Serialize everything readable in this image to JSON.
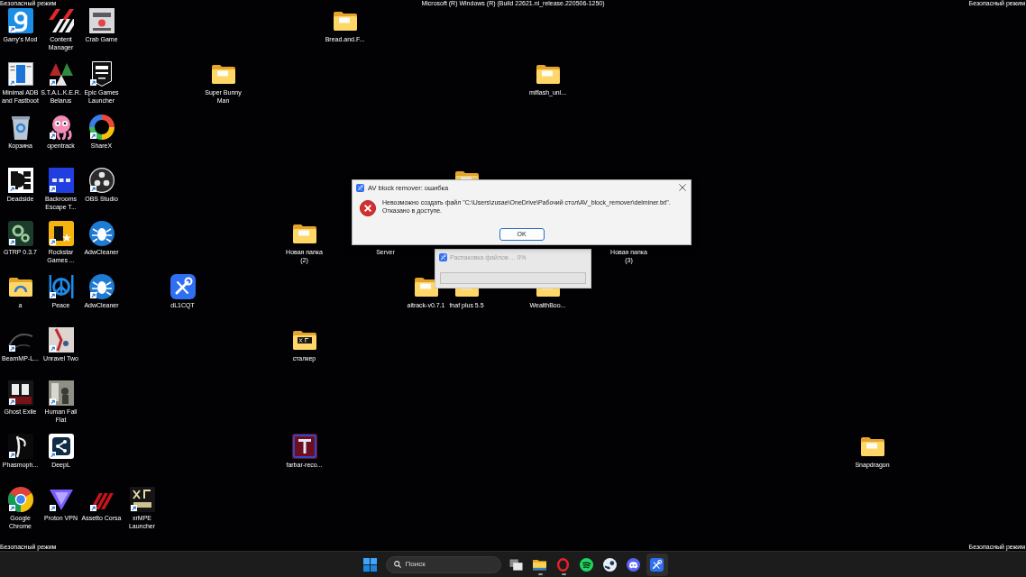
{
  "system_text": {
    "build": "Microsoft (R) Windows (R) (Build 22621.ni_release.220506-1250)",
    "safe_mode_labels": [
      "Безопасный режим",
      "Безопасный режим",
      "Безопасный режим",
      "Безопасный режим"
    ]
  },
  "desktop_icons": [
    {
      "label": "Garry's Mod",
      "kind": "app",
      "shortcut": true
    },
    {
      "label": "Content Manager",
      "kind": "app",
      "shortcut": false
    },
    {
      "label": "Crab Game",
      "kind": "app",
      "shortcut": false
    },
    {
      "label": "Bread.and.F...",
      "kind": "folder",
      "shortcut": false
    },
    {
      "label": "Minimal ADB and Fastboot",
      "kind": "app",
      "shortcut": true
    },
    {
      "label": "S.T.A.L.K.E.R. Belarus",
      "kind": "app",
      "shortcut": true
    },
    {
      "label": "Epic Games Launcher",
      "kind": "app",
      "shortcut": true
    },
    {
      "label": "Super Bunny Man",
      "kind": "folder",
      "shortcut": false
    },
    {
      "label": "miflash_unl...",
      "kind": "folder",
      "shortcut": false
    },
    {
      "label": "Корзина",
      "kind": "app",
      "shortcut": false
    },
    {
      "label": "opentrack",
      "kind": "app",
      "shortcut": true
    },
    {
      "label": "ShareX",
      "kind": "app",
      "shortcut": true
    },
    {
      "label": "Deadside",
      "kind": "app",
      "shortcut": true
    },
    {
      "label": "Backrooms Escape T...",
      "kind": "app",
      "shortcut": true
    },
    {
      "label": "OBS Studio",
      "kind": "app",
      "shortcut": true
    },
    {
      "kind": "folder"
    },
    {
      "label": "GTRP 0.3.7",
      "kind": "app",
      "shortcut": true
    },
    {
      "label": "Rockstar Games ...",
      "kind": "app",
      "shortcut": true
    },
    {
      "label": "AdwCleaner",
      "kind": "app",
      "shortcut": false
    },
    {
      "label": "Новая папка (2)",
      "kind": "folder",
      "shortcut": false
    },
    {
      "label": "Server",
      "kind": "covered"
    },
    {
      "label": "Новая папка (3)",
      "kind": "covered"
    },
    {
      "label": "a",
      "kind": "folder",
      "shortcut": false
    },
    {
      "label": "Peace",
      "kind": "app",
      "shortcut": true
    },
    {
      "label": "AdwCleaner",
      "kind": "app",
      "shortcut": true
    },
    {
      "label": "dL1CQT",
      "kind": "app",
      "shortcut": false
    },
    {
      "label": "aitrack-v0.7.1",
      "kind": "folder",
      "shortcut": false
    },
    {
      "label": "fnaf plus 5.5",
      "kind": "folder",
      "shortcut": false
    },
    {
      "label": "WealthBoo...",
      "kind": "folder",
      "shortcut": false
    },
    {
      "label": "BeamMP-L...",
      "kind": "app",
      "shortcut": true
    },
    {
      "label": "Unravel Two",
      "kind": "app",
      "shortcut": true
    },
    {
      "label": "сталкер",
      "kind": "folder",
      "shortcut": false
    },
    {
      "label": "Ghost Exile",
      "kind": "app",
      "shortcut": true
    },
    {
      "label": "Human Fall Flat",
      "kind": "app",
      "shortcut": true
    },
    {
      "label": "Phasmoph...",
      "kind": "app",
      "shortcut": true
    },
    {
      "label": "DeepL",
      "kind": "app",
      "shortcut": true
    },
    {
      "label": "farbar-reco...",
      "kind": "app",
      "shortcut": false
    },
    {
      "label": "Snapdragon",
      "kind": "folder",
      "shortcut": false
    },
    {
      "label": "Google Chrome",
      "kind": "app",
      "shortcut": true
    },
    {
      "label": "Proton VPN",
      "kind": "app",
      "shortcut": true
    },
    {
      "label": "Assetto Corsa",
      "kind": "app",
      "shortcut": true
    },
    {
      "label": "xrMPE Launcher",
      "kind": "app",
      "shortcut": true
    }
  ],
  "error_dialog": {
    "title": "AV block remover: ошибка",
    "active": true,
    "message": [
      "Невозможно создать файл \"C:\\Users\\zusae\\OneDrive\\Рабочий стол\\AV_block_remover\\delminer.txt\".",
      "Отказано в доступе."
    ],
    "button": "OK"
  },
  "progress_window": {
    "title": "Распаковка файлов ... 0%",
    "active": false,
    "level": 0
  },
  "taskbar": {
    "search": {
      "placeholder": "Поиск"
    },
    "buttons": [
      {
        "running": false,
        "active": false
      },
      {
        "running": true,
        "active": false
      },
      {
        "running": true,
        "active": false
      },
      {
        "running": false,
        "active": false
      },
      {
        "running": false,
        "active": false
      },
      {
        "running": false,
        "active": false
      },
      {
        "running": false,
        "active": true
      }
    ]
  }
}
